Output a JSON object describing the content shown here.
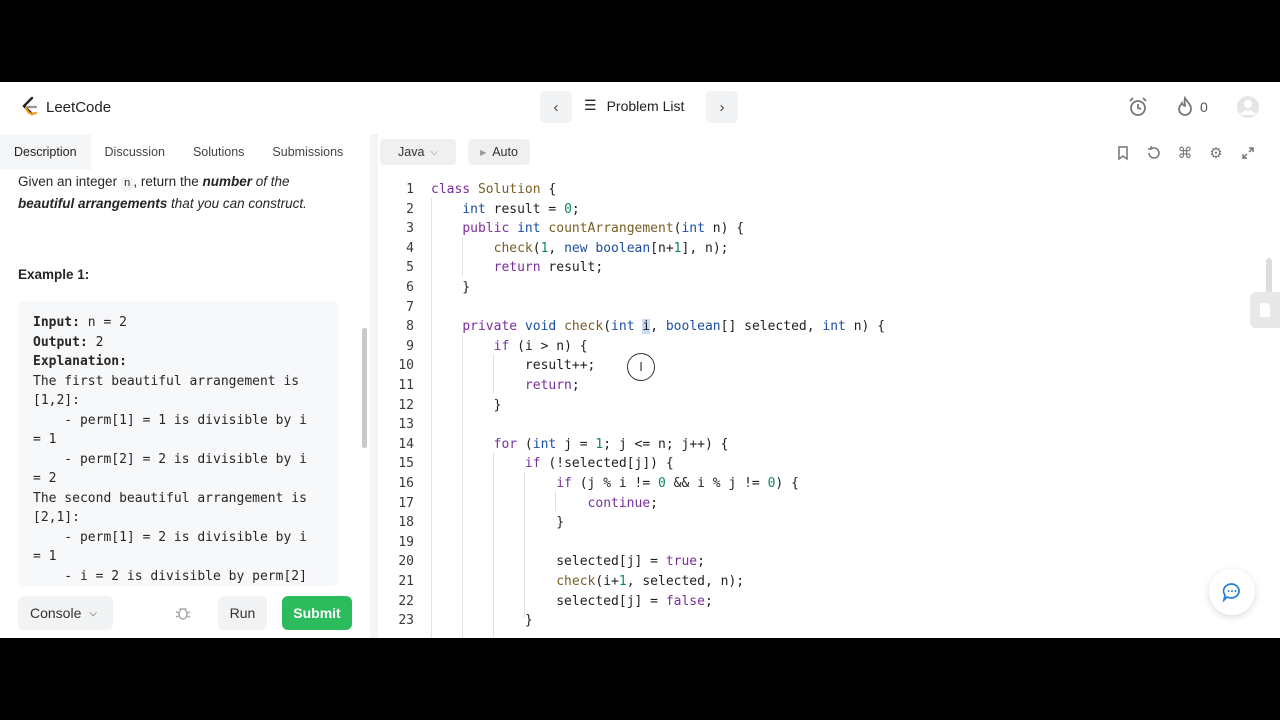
{
  "header": {
    "logo_text": "LeetCode",
    "problem_list_label": "Problem List",
    "streak_count": "0"
  },
  "tabs": [
    {
      "label": "Description",
      "active": true
    },
    {
      "label": "Discussion",
      "active": false
    },
    {
      "label": "Solutions",
      "active": false
    },
    {
      "label": "Submissions",
      "active": false
    }
  ],
  "description": {
    "text_1": "Given an integer ",
    "code_n": "n",
    "text_2": ", return the ",
    "bold_1": "number",
    "text_3": " of the ",
    "bold_2": "beautiful arrangements",
    "text_4": " that you can construct."
  },
  "example": {
    "title": "Example 1:",
    "lines": [
      "Input: n = 2",
      "Output: 2",
      "Explanation:",
      "The first beautiful arrangement is",
      "[1,2]:",
      "    - perm[1] = 1 is divisible by i",
      "= 1",
      "    - perm[2] = 2 is divisible by i",
      "= 2",
      "The second beautiful arrangement is",
      "[2,1]:",
      "    - perm[1] = 2 is divisible by i",
      "= 1",
      "    - i = 2 is divisible by perm[2]"
    ]
  },
  "bottom_bar": {
    "console_label": "Console",
    "run_label": "Run",
    "submit_label": "Submit"
  },
  "editor": {
    "language": "Java",
    "auto_label": "Auto",
    "code_lines": [
      "class Solution {",
      "    int result = 0;",
      "    public int countArrangement(int n) {",
      "        check(1, new boolean[n+1], n);",
      "        return result;",
      "    }",
      "",
      "    private void check(int i, boolean[] selected, int n) {",
      "        if (i > n) {",
      "            result++;",
      "            return;",
      "        }",
      "",
      "        for (int j = 1; j <= n; j++) {",
      "            if (!selected[j]) {",
      "                if (j % i != 0 && i % j != 0) {",
      "                    continue;",
      "                }",
      "",
      "                selected[j] = true;",
      "                check(i+1, selected, n);",
      "                selected[j] = false;",
      "            }"
    ]
  },
  "colors": {
    "submit_green": "#2cbb5d",
    "keyword_blue": "#1c4fa0",
    "keyword_purple": "#7a2e9b",
    "number_green": "#0a8a5b"
  }
}
